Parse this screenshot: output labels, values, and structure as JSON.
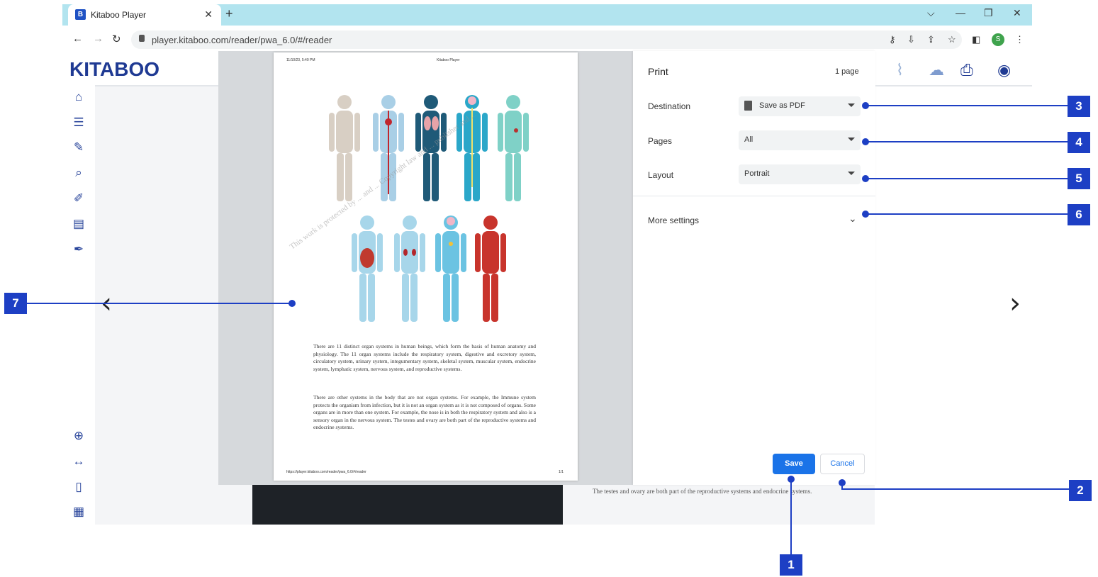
{
  "browser": {
    "tab_title": "Kitaboo Player",
    "tab_favicon": "B",
    "tab_close": "✕",
    "new_tab": "+",
    "url": "player.kitaboo.com/reader/pwa_6.0/#/reader",
    "profile_initial": "S"
  },
  "app": {
    "logo": "KITABOO",
    "bottom_text": "The testes and ovary are both part of the reproductive systems and endocrine systems."
  },
  "print_dialog": {
    "title": "Print",
    "page_count": "1 page",
    "destination": {
      "label": "Destination",
      "value": "Save as PDF"
    },
    "pages": {
      "label": "Pages",
      "value": "All"
    },
    "layout": {
      "label": "Layout",
      "value": "Portrait"
    },
    "more_settings": "More settings",
    "save_label": "Save",
    "cancel_label": "Cancel"
  },
  "preview": {
    "header_left": "11/10/23, 5:40 PM",
    "header_center": "Kitaboo Player",
    "footer_left": "https://player.kitaboo.com/reader/pwa_6.0/#/reader",
    "footer_right": "1/1",
    "watermark": "This work is protected by ... and ... Copyright law and ... publisher and ...",
    "paragraph_1": "There are 11 distinct organ systems in human beings, which form the basis of human anatomy and physiology. The 11 organ systems include the respiratory system, digestive and excretory system, circulatory system, urinary system, integumentary system, skeletal system, muscular system, endocrine system, lymphatic system, nervous system, and reproductive systems.",
    "paragraph_2": "There are other systems in the body that are not organ systems. For example, the Immune system protects the organism from infection, but it is not an organ system as it is not composed of organs. Some organs are in more than one system. For example, the nose is in both the respiratory system and also is a sensory organ in the nervous system. The testes and ovary are both part of the reproductive systems and endocrine systems."
  },
  "annotations": [
    "1",
    "2",
    "3",
    "4",
    "5",
    "6",
    "7"
  ],
  "icons": {
    "sidebar": [
      "home-icon",
      "toc-icon",
      "notes-icon",
      "search-icon",
      "pen-icon",
      "bookmark-icon",
      "highlighter-icon",
      "zoom-in-icon",
      "fit-width-icon",
      "page-icon",
      "grid-icon"
    ],
    "toolbar": [
      "clear-icon",
      "upload-icon",
      "print-icon",
      "profile-icon"
    ]
  },
  "colors": {
    "tab_strip": "#b2e4ef",
    "brand": "#1f3a93",
    "annotation": "#1d3fc4",
    "save_button": "#1a73e8"
  }
}
